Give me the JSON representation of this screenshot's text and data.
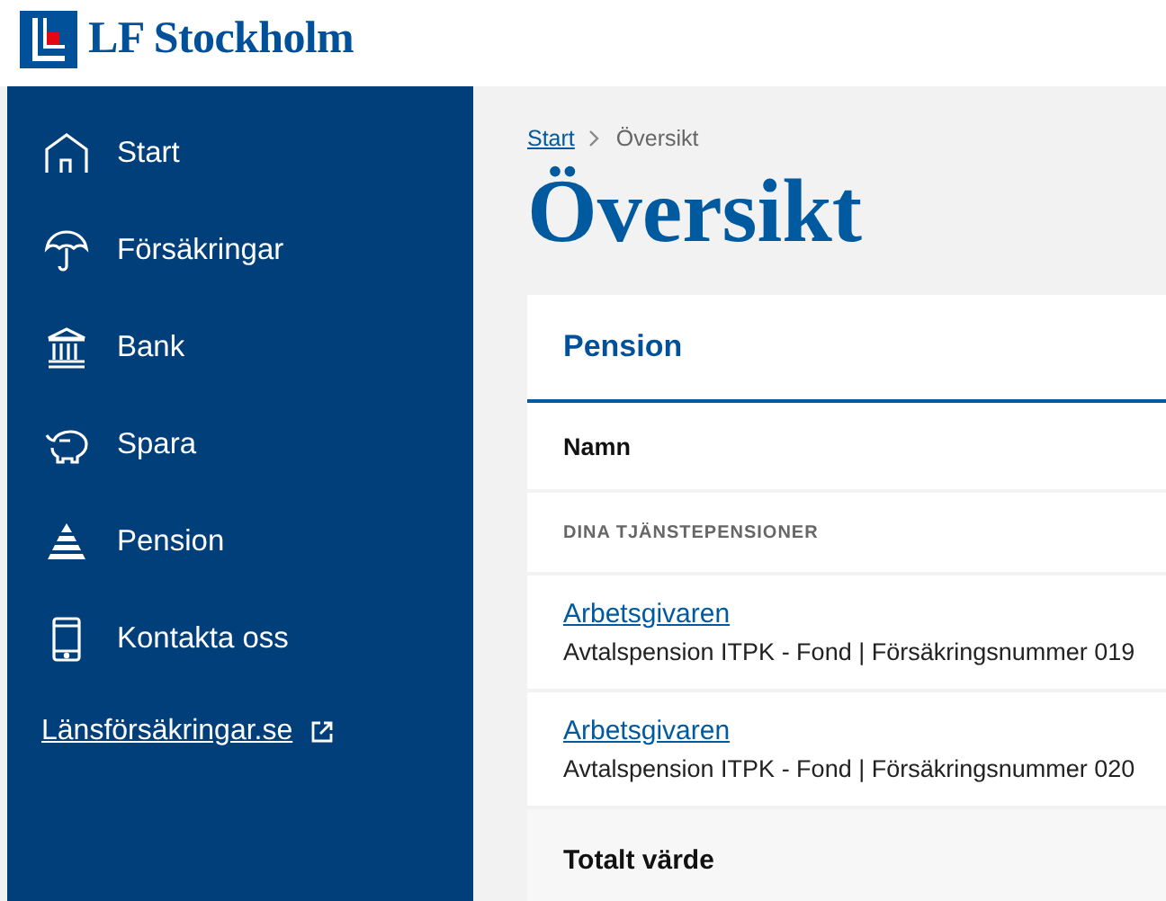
{
  "header": {
    "logo_text": "LF Stockholm"
  },
  "sidebar": {
    "items": [
      {
        "label": "Start"
      },
      {
        "label": "Försäkringar"
      },
      {
        "label": "Bank"
      },
      {
        "label": "Spara"
      },
      {
        "label": "Pension"
      },
      {
        "label": "Kontakta oss"
      }
    ],
    "external_link": "Länsförsäkringar.se"
  },
  "breadcrumb": [
    {
      "label": "Start",
      "kind": "link"
    },
    {
      "label": "Översikt",
      "kind": "current"
    }
  ],
  "page_title": "Översikt",
  "card": {
    "title": "Pension",
    "column_header": "Namn",
    "section": "DINA TJÄNSTEPENSIONER",
    "rows": [
      {
        "name": "Arbetsgivaren",
        "detail": "Avtalspension ITPK - Fond | Försäkringsnummer 019"
      },
      {
        "name": "Arbetsgivaren",
        "detail": "Avtalspension ITPK - Fond | Försäkringsnummer 020"
      }
    ],
    "total_label": "Totalt värde"
  }
}
